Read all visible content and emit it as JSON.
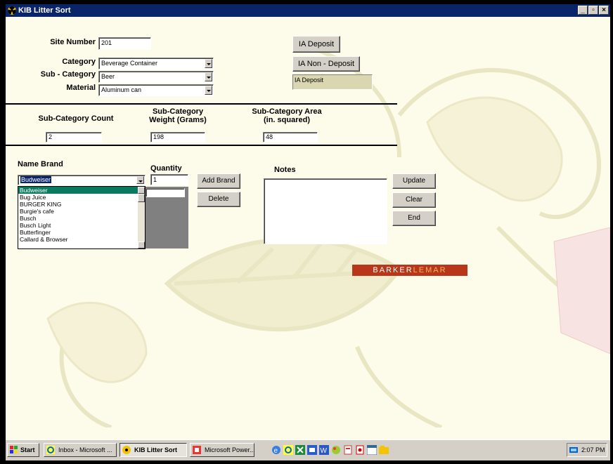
{
  "window": {
    "title": "KIB Litter Sort"
  },
  "form": {
    "site_number_label": "Site Number",
    "site_number_value": "201",
    "category_label": "Category",
    "category_value": "Beverage Container",
    "subcategory_label": "Sub - Category",
    "subcategory_value": "Beer",
    "material_label": "Material",
    "material_value": "Aluminum can"
  },
  "deposit": {
    "ia_deposit_button": "IA Deposit",
    "ia_non_deposit_button": "IA Non - Deposit",
    "status_value": "IA Deposit"
  },
  "stats": {
    "count_label": "Sub-Category Count",
    "count_value": "2",
    "weight_label_line1": "Sub-Category",
    "weight_label_line2": "Weight (Grams)",
    "weight_value": "198",
    "area_label_line1": "Sub-Category Area",
    "area_label_line2": "(in. squared)",
    "area_value": "48"
  },
  "brand": {
    "label": "Name Brand",
    "selected": "Budweiser",
    "items": [
      "Budweiser",
      "Bug Juice",
      "BURGER KING",
      "Burgie's cafe",
      "Busch",
      "Busch Light",
      "Butterfinger",
      "Callard & Browser"
    ],
    "selected_index": 0
  },
  "quantity": {
    "label": "Quantity",
    "value": "1"
  },
  "actions": {
    "add_brand": "Add Brand",
    "delete": "Delete",
    "update": "Update",
    "clear": "Clear",
    "end": "End"
  },
  "notes": {
    "label": "Notes",
    "value": ""
  },
  "logo": {
    "part1": "BARKER",
    "part2": "LEMAR"
  },
  "taskbar": {
    "start": "Start",
    "tasks": [
      "Inbox - Microsoft ...",
      "KIB Litter Sort",
      "Microsoft Power..."
    ],
    "clock": "2:07 PM"
  },
  "colors": {
    "title_bar": "#0a246a",
    "selection": "#0a7a5e",
    "logo_bg": "#b8371a",
    "form_bg": "#fdfbe9"
  }
}
